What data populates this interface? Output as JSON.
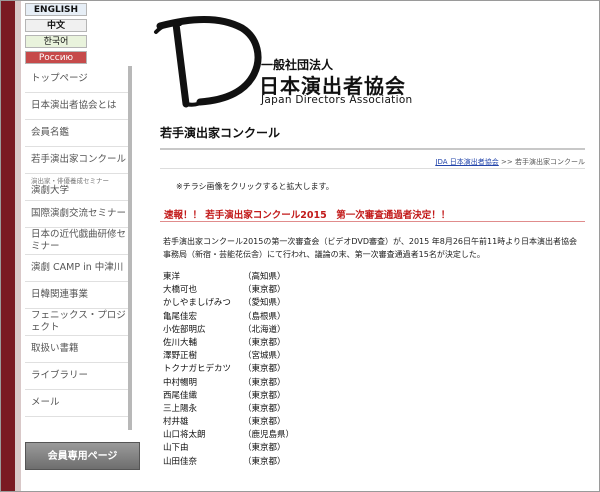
{
  "languages": [
    {
      "label": "ENGLISH"
    },
    {
      "label": "中文"
    },
    {
      "label": "한국어"
    },
    {
      "label": "Россию"
    }
  ],
  "logo": {
    "letter": "D",
    "org_type": "一般社団法人",
    "name": "日本演出者協会",
    "english": "Japan Directors Association"
  },
  "sidebar": {
    "items": [
      {
        "label": "トップページ"
      },
      {
        "label": "日本演出者協会とは"
      },
      {
        "label": "会員名鑑"
      },
      {
        "label": "若手演出家コンクール"
      },
      {
        "small": "演出家・俳優養成セミナー",
        "label": "演劇大学"
      },
      {
        "label": "国際演劇交流セミナー"
      },
      {
        "label": "日本の近代戯曲研修セミナー"
      },
      {
        "label": "演劇 CAMP in 中津川"
      },
      {
        "label": "日韓関連事業"
      },
      {
        "label": "フェニックス・プロジェクト"
      },
      {
        "label": "取扱い書籍"
      },
      {
        "label": "ライブラリー"
      },
      {
        "label": "メール"
      }
    ],
    "member_button": "会員専用ページ"
  },
  "main": {
    "page_title": "若手演出家コンクール",
    "breadcrumb": {
      "link": "JDA 日本演出者協会",
      "separator": " >> ",
      "current": "若手演出家コンクール"
    },
    "note": "※チラシ画像をクリックすると拡大します。",
    "headline": "速報！！ 若手演出家コンクール2015　第一次審査通過者決定！！",
    "body": "若手演出家コンクール2015の第一次審査会（ビデオDVD審査）が、2015 年8月26日午前11時より日本演出者協会事務局（新宿・芸能花伝舎）にて行われ、議論の末、第一次審査通過者15名が決定した。",
    "finalists": [
      {
        "name": "東洋",
        "pref": "（高知県）"
      },
      {
        "name": "大橋可也",
        "pref": "（東京都）"
      },
      {
        "name": "かしやましげみつ",
        "pref": "（愛知県）"
      },
      {
        "name": "亀尾佳宏",
        "pref": "（島根県）"
      },
      {
        "name": "小佐部明広",
        "pref": "（北海道）"
      },
      {
        "name": "佐川大輔",
        "pref": "（東京都）"
      },
      {
        "name": "澤野正樹",
        "pref": "（宮城県）"
      },
      {
        "name": "トクナガヒデカツ",
        "pref": "（東京都）"
      },
      {
        "name": "中村暢明",
        "pref": "（東京都）"
      },
      {
        "name": "西尾佳織",
        "pref": "（東京都）"
      },
      {
        "name": "三上陽永",
        "pref": "（東京都）"
      },
      {
        "name": "村井雄",
        "pref": "（東京都）"
      },
      {
        "name": "山口将太朗",
        "pref": "（鹿児島県）"
      },
      {
        "name": "山下由",
        "pref": "（東京都）"
      },
      {
        "name": "山田佳奈",
        "pref": "（東京都）"
      }
    ]
  },
  "colors": {
    "left_strip": "#7a1a22",
    "headline": "#c21a1a",
    "russian_button": "#c64a4a"
  }
}
